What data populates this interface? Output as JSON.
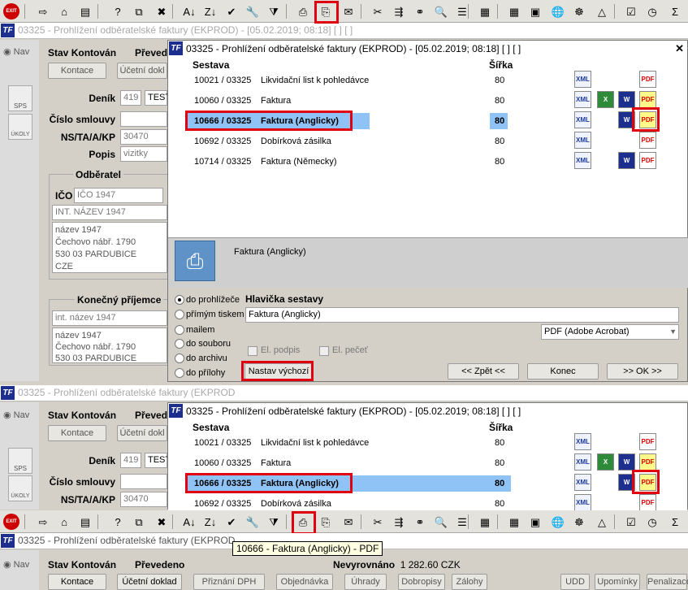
{
  "toolbar": {
    "exit_label": "EXIT",
    "icons": [
      "exit-icon",
      "send-icon",
      "home-icon",
      "folder-icon",
      "calculator-question-icon",
      "copy-icon",
      "delete-doc-icon",
      "sort-az-icon",
      "sort-za-icon",
      "checkmark-icon",
      "wrench-icon",
      "filter-icon",
      "print-icon",
      "print-preview-icon",
      "email-icon",
      "scissors-icon",
      "tree-icon",
      "link-icon",
      "find-icon",
      "list-icon",
      "grid-icon",
      "calc-icon",
      "image-icon",
      "globe-icon",
      "helm-icon",
      "tent-icon",
      "checklist-icon",
      "clock-icon",
      "sigma-icon"
    ],
    "glyphs": [
      "EXIT",
      "⇨",
      "⌂",
      "▤",
      "?",
      "⧉",
      "✖",
      "A↓",
      "Z↓",
      "✔",
      "🔧",
      "⧩",
      "⎙",
      "⎘",
      "✉",
      "✂",
      "⇶",
      "⚭",
      "🔍",
      "☰",
      "▦",
      "▦",
      "▣",
      "🌐",
      "☸",
      "△",
      "☑",
      "◷",
      "Σ"
    ]
  },
  "window_title": "03325 - Prohlížení odběratelské faktury (EKPROD) - [05.02.2019; 08:18]  [ ]  [ ]",
  "window_title_short": "03325 - Prohlížení odběratelské faktury (EKPROD",
  "bg_form": {
    "nav": "Nav",
    "stav_label": "Stav",
    "stav_value": "Kontován",
    "prevedeno": "Převedeno",
    "prevede_short": "Převed",
    "kontace_button": "Kontace",
    "ucetni_doklad_button": "Účetní doklad",
    "ucetni_doklad_short": "Účetní dokl",
    "sps": "SPS",
    "ukoly": "ÚKOLY",
    "denik_label": "Deník",
    "denik_value": "419",
    "denik_value2": "TEST",
    "cislo_smlouvy_label": "Číslo smlouvy",
    "ns_label": "NS/TA/A/KP",
    "ns_value": "30470",
    "popis_label": "Popis",
    "popis_value": "vizitky",
    "odberatel_label": "Odběratel",
    "ico_label": "IČO",
    "ico_value": "IČO 1947",
    "int_nazev_value": "INT. NÁZEV 1947",
    "addr_line1": "název 1947",
    "addr_line2": "Čechovo nábř. 1790",
    "addr_line3": "530 03 PARDUBICE",
    "addr_line4": "CZE",
    "konecny_prijemce_label": "Konečný příjemce",
    "kp_int_nazev": "int. název 1947",
    "kp_addr_line1": "název 1947",
    "kp_addr_line2": "Čechovo nábř. 1790",
    "kp_addr_line3": "530 03 PARDUBICE"
  },
  "dialog": {
    "title": "03325 - Prohlížení odběratelské faktury (EKPROD) - [05.02.2019; 08:18]  [ ]  [ ]",
    "col_sestava": "Sestava",
    "col_sirka": "Šířka",
    "rows": [
      {
        "code": "10021 / 03325",
        "name": "Likvidační list k pohledávce",
        "width": "80"
      },
      {
        "code": "10060 / 03325",
        "name": "Faktura",
        "width": "80"
      },
      {
        "code": "10666 / 03325",
        "name": "Faktura (Anglicky)",
        "width": "80"
      },
      {
        "code": "10692 / 03325",
        "name": "Dobírková zásilka",
        "width": "80"
      },
      {
        "code": "10714 / 03325",
        "name": "Faktura (Německy)",
        "width": "80"
      }
    ],
    "selected_name": "Faktura (Anglicky)",
    "radio_prohlizece": "do prohlížeče",
    "radio_tiskem": "přímým tiskem",
    "radio_mailem": "mailem",
    "radio_souboru": "do souboru",
    "radio_archivu": "do archivu",
    "radio_prilohy": "do přílohy",
    "hlavicka_label": "Hlavička sestavy",
    "hlavicka_value": "Faktura (Anglicky)",
    "format_value": "PDF (Adobe Acrobat)",
    "el_podpis": "El. podpis",
    "el_pecet": "El. pečeť",
    "nastav_vychozi": "Nastav výchozí",
    "zpet_button": "<< Zpět <<",
    "konec_button": "Konec",
    "ok_button": ">> OK >>"
  },
  "bottom": {
    "tooltip": "10666 - Faktura (Anglicky) - PDF",
    "nevyrovnano_label": "Nevyrovnáno",
    "nevyrovnano_value": "1 282.60 CZK",
    "buttons": [
      "Kontace",
      "Účetní doklad",
      "Přiznání DPH",
      "Objednávka",
      "Úhrady",
      "Dobropisy",
      "Zálohy",
      "UDD",
      "Upomínky",
      "Penalizace"
    ]
  }
}
